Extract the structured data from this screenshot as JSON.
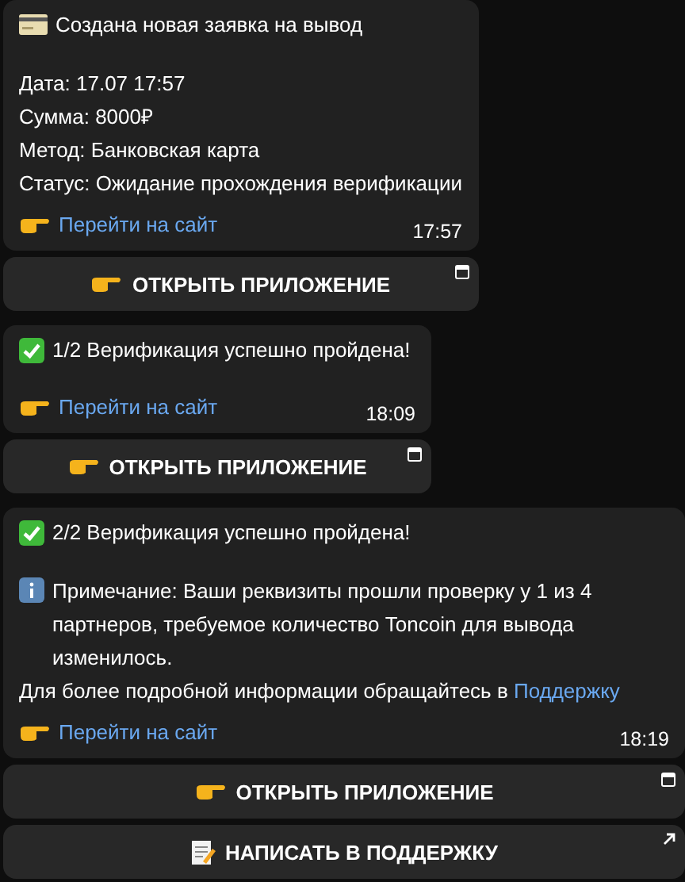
{
  "messages": [
    {
      "kind": "request",
      "title": "Создана новая заявка на вывод",
      "lines": [
        "Дата: 17.07 17:57",
        "Сумма: 8000₽",
        "Метод: Банковская карта",
        "Статус: Ожидание прохождения верификации"
      ],
      "link": "Перейти на сайт",
      "time": "17:57",
      "buttons": [
        {
          "kind": "web_app",
          "label": "ОТКРЫТЬ ПРИЛОЖЕНИЕ"
        }
      ]
    },
    {
      "kind": "verification",
      "title": "1/2 Верификация успешно пройдена!",
      "link": "Перейти на сайт",
      "time": "18:09",
      "buttons": [
        {
          "kind": "web_app",
          "label": "ОТКРЫТЬ ПРИЛОЖЕНИЕ"
        }
      ]
    },
    {
      "kind": "verification",
      "title": "2/2 Верификация успешно пройдена!",
      "note": {
        "text": "Примечание: Ваши реквизиты прошли проверку у 1 из 4 партнеров, требуемое количество Toncoin для вывода изменилось.",
        "more": "Для более подробной информации обращайтесь в",
        "link": "Поддержку"
      },
      "link": "Перейти на сайт",
      "time": "18:19",
      "buttons": [
        {
          "kind": "web_app",
          "label": "ОТКРЫТЬ ПРИЛОЖЕНИЕ"
        },
        {
          "kind": "url",
          "label": "НАПИСАТЬ В ПОДДЕРЖКУ"
        }
      ]
    }
  ]
}
